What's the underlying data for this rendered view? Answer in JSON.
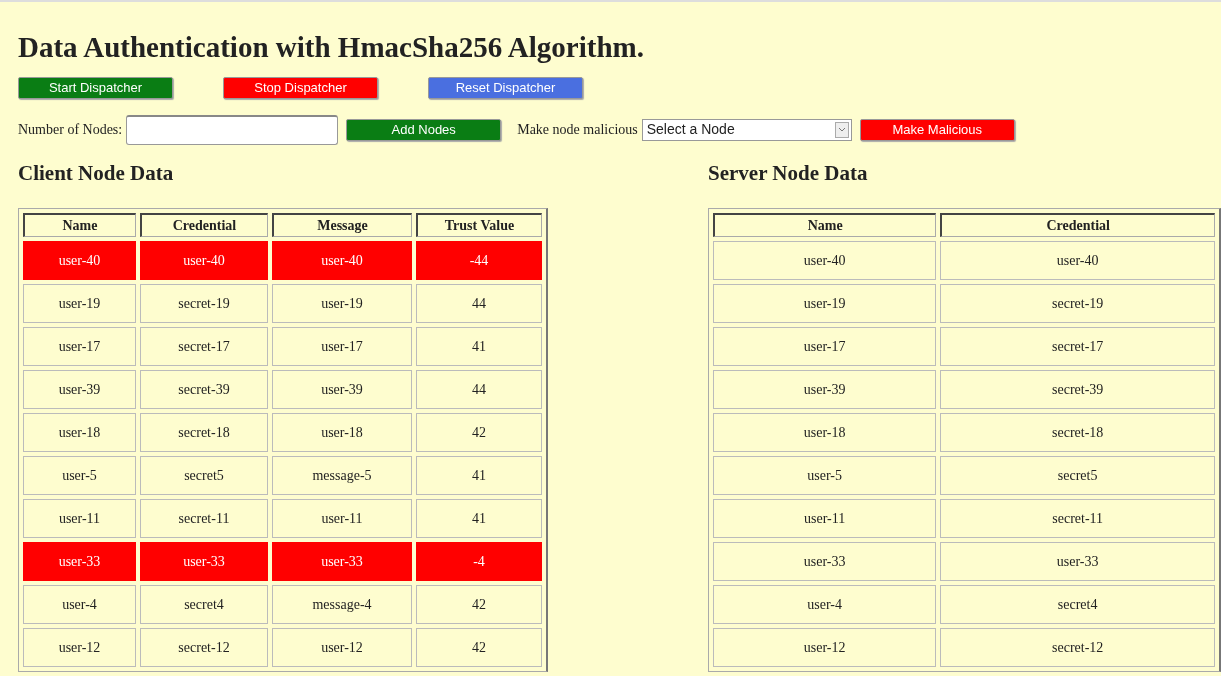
{
  "title": "Data Authentication with HmacSha256 Algorithm.",
  "dispatcher_buttons": [
    {
      "label": "Start Dispatcher",
      "kind": "start"
    },
    {
      "label": "Stop Dispatcher",
      "kind": "stop"
    },
    {
      "label": "Reset Dispatcher",
      "kind": "reset"
    }
  ],
  "nodes_form": {
    "label": "Number of Nodes:",
    "button": "Add Nodes"
  },
  "malicious_form": {
    "label": "Make node malicious",
    "select_value": "Select a Node",
    "button": "Make Malicious"
  },
  "client_table": {
    "title": "Client Node Data",
    "columns": [
      "Name",
      "Credential",
      "Message",
      "Trust Value"
    ],
    "rows": [
      {
        "cells": [
          "user-40",
          "user-40",
          "user-40",
          "-44"
        ],
        "malicious": true
      },
      {
        "cells": [
          "user-19",
          "secret-19",
          "user-19",
          "44"
        ],
        "malicious": false
      },
      {
        "cells": [
          "user-17",
          "secret-17",
          "user-17",
          "41"
        ],
        "malicious": false
      },
      {
        "cells": [
          "user-39",
          "secret-39",
          "user-39",
          "44"
        ],
        "malicious": false
      },
      {
        "cells": [
          "user-18",
          "secret-18",
          "user-18",
          "42"
        ],
        "malicious": false
      },
      {
        "cells": [
          "user-5",
          "secret5",
          "message-5",
          "41"
        ],
        "malicious": false
      },
      {
        "cells": [
          "user-11",
          "secret-11",
          "user-11",
          "41"
        ],
        "malicious": false
      },
      {
        "cells": [
          "user-33",
          "user-33",
          "user-33",
          "-4"
        ],
        "malicious": true
      },
      {
        "cells": [
          "user-4",
          "secret4",
          "message-4",
          "42"
        ],
        "malicious": false
      },
      {
        "cells": [
          "user-12",
          "secret-12",
          "user-12",
          "42"
        ],
        "malicious": false
      }
    ]
  },
  "server_table": {
    "title": "Server Node Data",
    "columns": [
      "Name",
      "Credential"
    ],
    "rows": [
      {
        "cells": [
          "user-40",
          "user-40"
        ]
      },
      {
        "cells": [
          "user-19",
          "secret-19"
        ]
      },
      {
        "cells": [
          "user-17",
          "secret-17"
        ]
      },
      {
        "cells": [
          "user-39",
          "secret-39"
        ]
      },
      {
        "cells": [
          "user-18",
          "secret-18"
        ]
      },
      {
        "cells": [
          "user-5",
          "secret5"
        ]
      },
      {
        "cells": [
          "user-11",
          "secret-11"
        ]
      },
      {
        "cells": [
          "user-33",
          "user-33"
        ]
      },
      {
        "cells": [
          "user-4",
          "secret4"
        ]
      },
      {
        "cells": [
          "user-12",
          "secret-12"
        ]
      }
    ]
  }
}
